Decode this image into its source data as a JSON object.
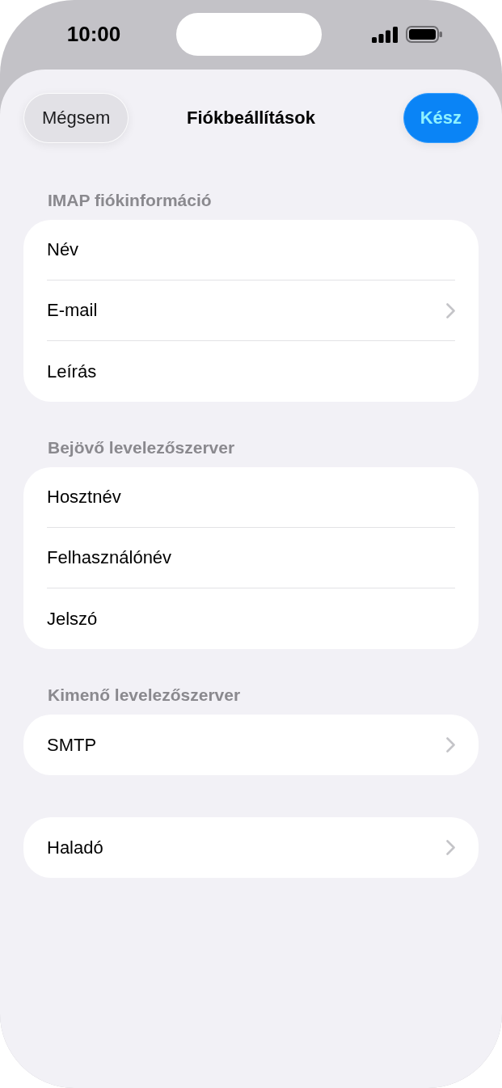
{
  "status_bar": {
    "time": "10:00"
  },
  "nav": {
    "cancel": "Mégsem",
    "title": "Fiókbeállítások",
    "done": "Kész"
  },
  "sections": [
    {
      "header": "IMAP fiókinformáció",
      "rows": [
        {
          "label": "Név",
          "chevron": false
        },
        {
          "label": "E-mail",
          "chevron": true
        },
        {
          "label": "Leírás",
          "chevron": false
        }
      ]
    },
    {
      "header": "Bejövő levelezőszerver",
      "rows": [
        {
          "label": "Hosztnév",
          "chevron": false
        },
        {
          "label": "Felhasználónév",
          "chevron": false
        },
        {
          "label": "Jelszó",
          "chevron": false
        }
      ]
    },
    {
      "header": "Kimenő levelezőszerver",
      "rows": [
        {
          "label": "SMTP",
          "chevron": true
        }
      ]
    },
    {
      "rows": [
        {
          "label": "Haladó",
          "chevron": true
        }
      ]
    }
  ]
}
